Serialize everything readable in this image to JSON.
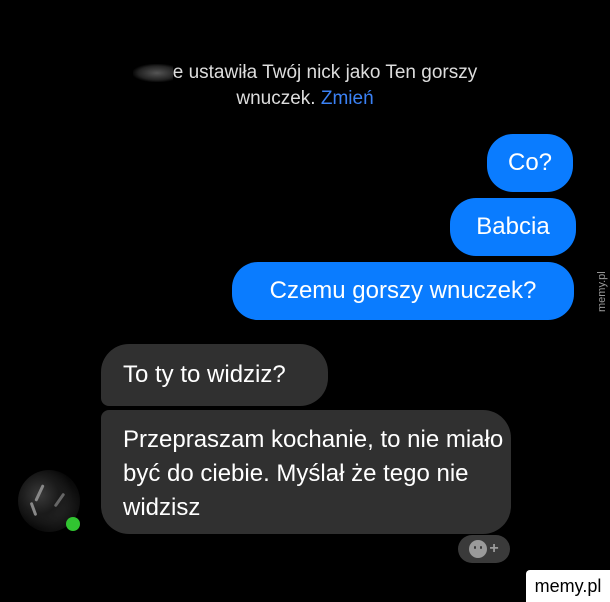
{
  "system_message": {
    "line1": "e ustawiła Twój nick jako Ten gorszy",
    "line2": "wnuczek.",
    "link": "Zmień"
  },
  "messages_outgoing": [
    {
      "text": "Co?"
    },
    {
      "text": "Babcia"
    },
    {
      "text": "Czemu gorszy wnuczek?"
    }
  ],
  "messages_incoming": [
    {
      "text": "To ty to widziz?"
    },
    {
      "text": "Przepraszam kochanie, to nie miało być do ciebie. Myślał że tego nie widzisz"
    }
  ],
  "reaction_button": {
    "plus": "+",
    "icon": "smiley-add-icon"
  },
  "watermarks": {
    "side": "memy.pl",
    "corner": "memy.pl"
  },
  "colors": {
    "background": "#000000",
    "outgoing_bubble": "#0a7cff",
    "incoming_bubble": "#303030",
    "link": "#3b82f6",
    "online_indicator": "#31c431"
  }
}
